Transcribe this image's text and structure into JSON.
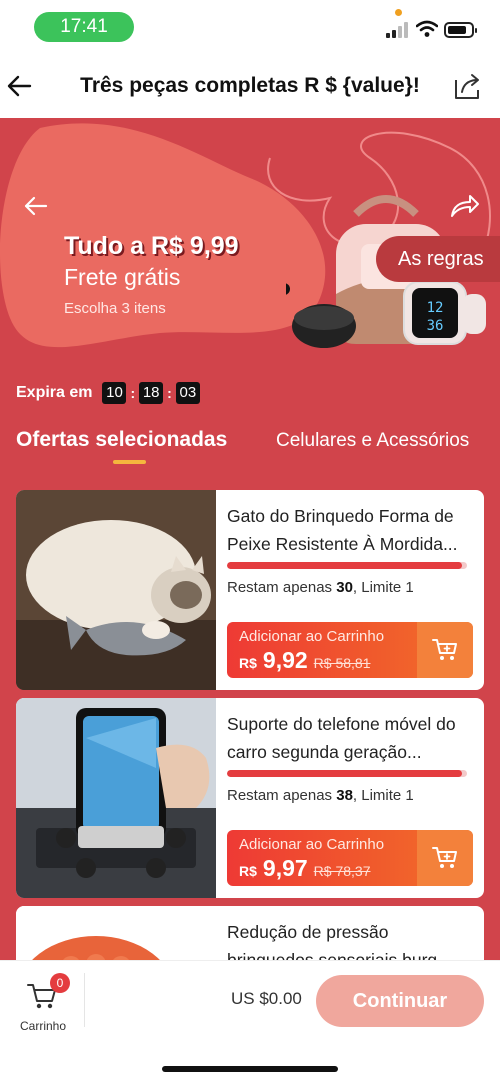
{
  "status_bar": {
    "time": "17:41"
  },
  "header": {
    "title": "Três peças completas R $ {value}!"
  },
  "banner": {
    "title": "Tudo a R$ 9,99",
    "subtitle": "Frete grátis",
    "note": "Escolha 3 itens",
    "rules_label": "As regras",
    "colors": {
      "background": "#d1444b",
      "blob": "#ea6a61"
    }
  },
  "countdown": {
    "label": "Expira em",
    "hours": "10",
    "minutes": "18",
    "seconds": "03"
  },
  "tabs": [
    {
      "label": "Ofertas selecionadas",
      "active": true
    },
    {
      "label": "Celulares e Acessórios",
      "active": false
    }
  ],
  "products": [
    {
      "title": "Gato do Brinquedo Forma de Peixe Resistente À Mordida...",
      "stock_prefix": "Restam apenas ",
      "stock_count": "30",
      "stock_suffix": ", Limite 1",
      "add_label": "Adicionar ao Carrinho",
      "currency": "R$",
      "price": "9,92",
      "old_price": "R$ 58,81",
      "progress": 0.98
    },
    {
      "title": "Suporte do telefone móvel do carro segunda geração...",
      "stock_prefix": "Restam apenas ",
      "stock_count": "38",
      "stock_suffix": ", Limite 1",
      "add_label": "Adicionar ao Carrinho",
      "currency": "R$",
      "price": "9,97",
      "old_price": "R$ 78,37",
      "progress": 0.98
    },
    {
      "title": "Redução de pressão brinquedos sensoriais burg..."
    }
  ],
  "bottom_bar": {
    "cart_label": "Carrinho",
    "cart_count": "0",
    "total": "US $0.00",
    "continue_label": "Continuar"
  }
}
